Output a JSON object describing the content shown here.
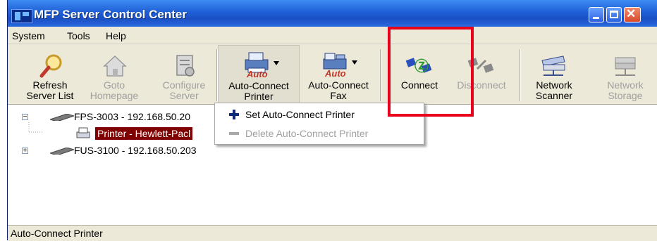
{
  "window": {
    "title": "MFP Server Control Center",
    "controls": [
      "minimize",
      "maximize",
      "close"
    ]
  },
  "menubar": {
    "items": [
      "System",
      "Tools",
      "Help"
    ]
  },
  "toolbar": {
    "buttons": [
      {
        "line1": "Refresh",
        "line2": "Server List",
        "line2_disabled": false,
        "icon": "magnifier-icon"
      },
      {
        "line1": "Goto",
        "line2": "Homepage",
        "disabled": true,
        "icon": "home-icon"
      },
      {
        "line1": "Configure",
        "line2": "Server",
        "disabled": true,
        "icon": "configure-icon"
      },
      {
        "line1": "Auto-Connect",
        "line2": "Printer",
        "icon_text": "Auto",
        "icon": "auto-connect-printer-icon"
      },
      {
        "line1": "Auto-Connect",
        "line2": "Fax",
        "icon_text": "Auto",
        "icon": "auto-connect-fax-icon"
      },
      {
        "line1": "Connect",
        "icon": "connect-icon"
      },
      {
        "line1": "Disconnect",
        "disabled": true,
        "icon": "disconnect-icon"
      },
      {
        "line1": "Network",
        "line2": "Scanner",
        "icon": "network-scanner-icon"
      },
      {
        "line1": "Network",
        "line2": "Storage",
        "disabled": true,
        "icon": "network-storage-icon"
      }
    ]
  },
  "tree": {
    "nodes": [
      {
        "label": "FPS-3003 - 192.168.50.20",
        "expander": "−"
      },
      {
        "label": "Printer - Hewlett-Pacl",
        "selected": true
      },
      {
        "label": "FUS-3100 - 192.168.50.203",
        "expander": "+"
      }
    ]
  },
  "dropdown_menu": {
    "items": [
      {
        "label": "Set Auto-Connect Printer",
        "icon": "plus-icon",
        "disabled": false
      },
      {
        "label": "Delete Auto-Connect Printer",
        "icon": "minus-icon",
        "disabled": true
      }
    ]
  },
  "statusbar": {
    "text": "Auto-Connect Printer"
  },
  "colors": {
    "title_bar": "#1f5fd6",
    "selection": "#800000",
    "annotation_box": "#e8001c"
  }
}
